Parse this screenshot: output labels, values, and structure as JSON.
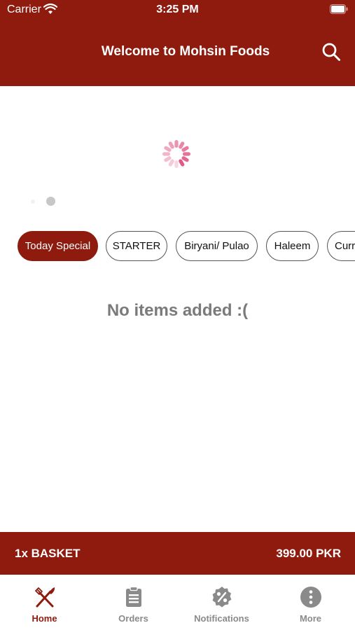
{
  "status_bar": {
    "carrier": "Carrier",
    "time": "3:25 PM"
  },
  "header": {
    "title": "Welcome to Mohsin Foods",
    "search_icon": "search-icon"
  },
  "categories": {
    "items": [
      {
        "label": "Today Special",
        "active": true
      },
      {
        "label": "STARTER",
        "active": false
      },
      {
        "label": "Biryani/ Pulao",
        "active": false
      },
      {
        "label": "Haleem",
        "active": false
      },
      {
        "label": "Curr",
        "active": false
      }
    ]
  },
  "main": {
    "empty_message": "No items added :("
  },
  "basket": {
    "count_label": "1x BASKET",
    "total": "399.00 PKR"
  },
  "tabbar": {
    "items": [
      {
        "label": "Home",
        "icon": "fork-knife-icon",
        "active": true
      },
      {
        "label": "Orders",
        "icon": "clipboard-icon",
        "active": false
      },
      {
        "label": "Notifications",
        "icon": "percent-badge-icon",
        "active": false
      },
      {
        "label": "More",
        "icon": "more-icon",
        "active": false
      }
    ]
  },
  "colors": {
    "brand": "#8e1b0e",
    "spinner": "#e05a86",
    "inactive": "#8a8a8a"
  }
}
